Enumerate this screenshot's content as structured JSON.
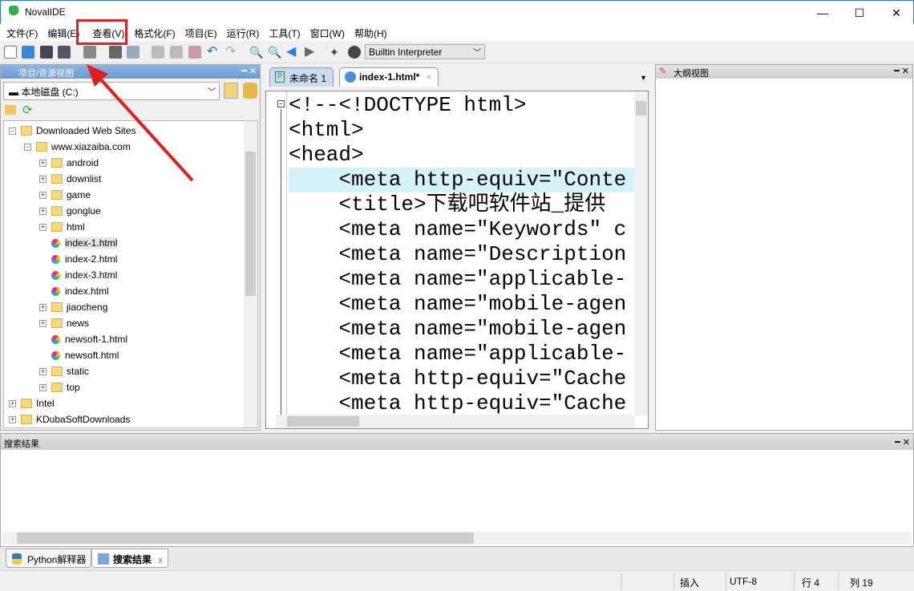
{
  "app": {
    "title": "NovalIDE"
  },
  "menu": [
    "文件(F)",
    "编辑(E)",
    "查看(V)",
    "格式化(F)",
    "项目(E)",
    "运行(R)",
    "工具(T)",
    "窗口(W)",
    "帮助(H)"
  ],
  "toolbar": {
    "interpreter": "Builtin Interpreter"
  },
  "left_panel": {
    "title": "项目/资源视图",
    "drive": "本地磁盘 (C:)",
    "tree": [
      {
        "label": "Downloaded Web Sites",
        "level": 0,
        "type": "folder",
        "exp": "-"
      },
      {
        "label": "www.xiazaiba.com",
        "level": 1,
        "type": "folder",
        "exp": "-"
      },
      {
        "label": "android",
        "level": 2,
        "type": "folder",
        "exp": "+"
      },
      {
        "label": "downlist",
        "level": 2,
        "type": "folder",
        "exp": "+"
      },
      {
        "label": "game",
        "level": 2,
        "type": "folder",
        "exp": "+"
      },
      {
        "label": "gonglue",
        "level": 2,
        "type": "folder",
        "exp": "+"
      },
      {
        "label": "html",
        "level": 2,
        "type": "folder",
        "exp": "+"
      },
      {
        "label": "index-1.html",
        "level": 2,
        "type": "file",
        "selected": true
      },
      {
        "label": "index-2.html",
        "level": 2,
        "type": "file"
      },
      {
        "label": "index-3.html",
        "level": 2,
        "type": "file"
      },
      {
        "label": "index.html",
        "level": 2,
        "type": "file"
      },
      {
        "label": "jiaocheng",
        "level": 2,
        "type": "folder",
        "exp": "+"
      },
      {
        "label": "news",
        "level": 2,
        "type": "folder",
        "exp": "+"
      },
      {
        "label": "newsoft-1.html",
        "level": 2,
        "type": "file"
      },
      {
        "label": "newsoft.html",
        "level": 2,
        "type": "file"
      },
      {
        "label": "static",
        "level": 2,
        "type": "folder",
        "exp": "+"
      },
      {
        "label": "top",
        "level": 2,
        "type": "folder",
        "exp": "+"
      },
      {
        "label": "Intel",
        "level": 0,
        "type": "folder",
        "exp": "+"
      },
      {
        "label": "KDubaSoftDownloads",
        "level": 0,
        "type": "folder",
        "exp": "+"
      }
    ]
  },
  "editor": {
    "tabs": [
      {
        "label": "未命名 1"
      },
      {
        "label": "index-1.html*",
        "active": true
      }
    ],
    "lines": [
      "<!--<!DOCTYPE html>",
      "<html>",
      "<head>",
      "    <meta http-equiv=\"Conte",
      "    <title>下载吧软件站_提供",
      "    <meta name=\"Keywords\" c",
      "    <meta name=\"Description",
      "    <meta name=\"applicable-",
      "    <meta name=\"mobile-agen",
      "    <meta name=\"mobile-agen",
      "    <meta name=\"applicable-",
      "    <meta http-equiv=\"Cache",
      "    <meta http-equiv=\"Cache"
    ],
    "current_line": 3
  },
  "outline": {
    "title": "大纲视图"
  },
  "search": {
    "title": "搜索结果"
  },
  "bottom_tabs": [
    {
      "label": "Python解释器"
    },
    {
      "label": "搜索结果",
      "active": true
    }
  ],
  "status": {
    "mode": "插入",
    "encoding": "UTF-8",
    "line": "行 4",
    "col": "列 19"
  }
}
